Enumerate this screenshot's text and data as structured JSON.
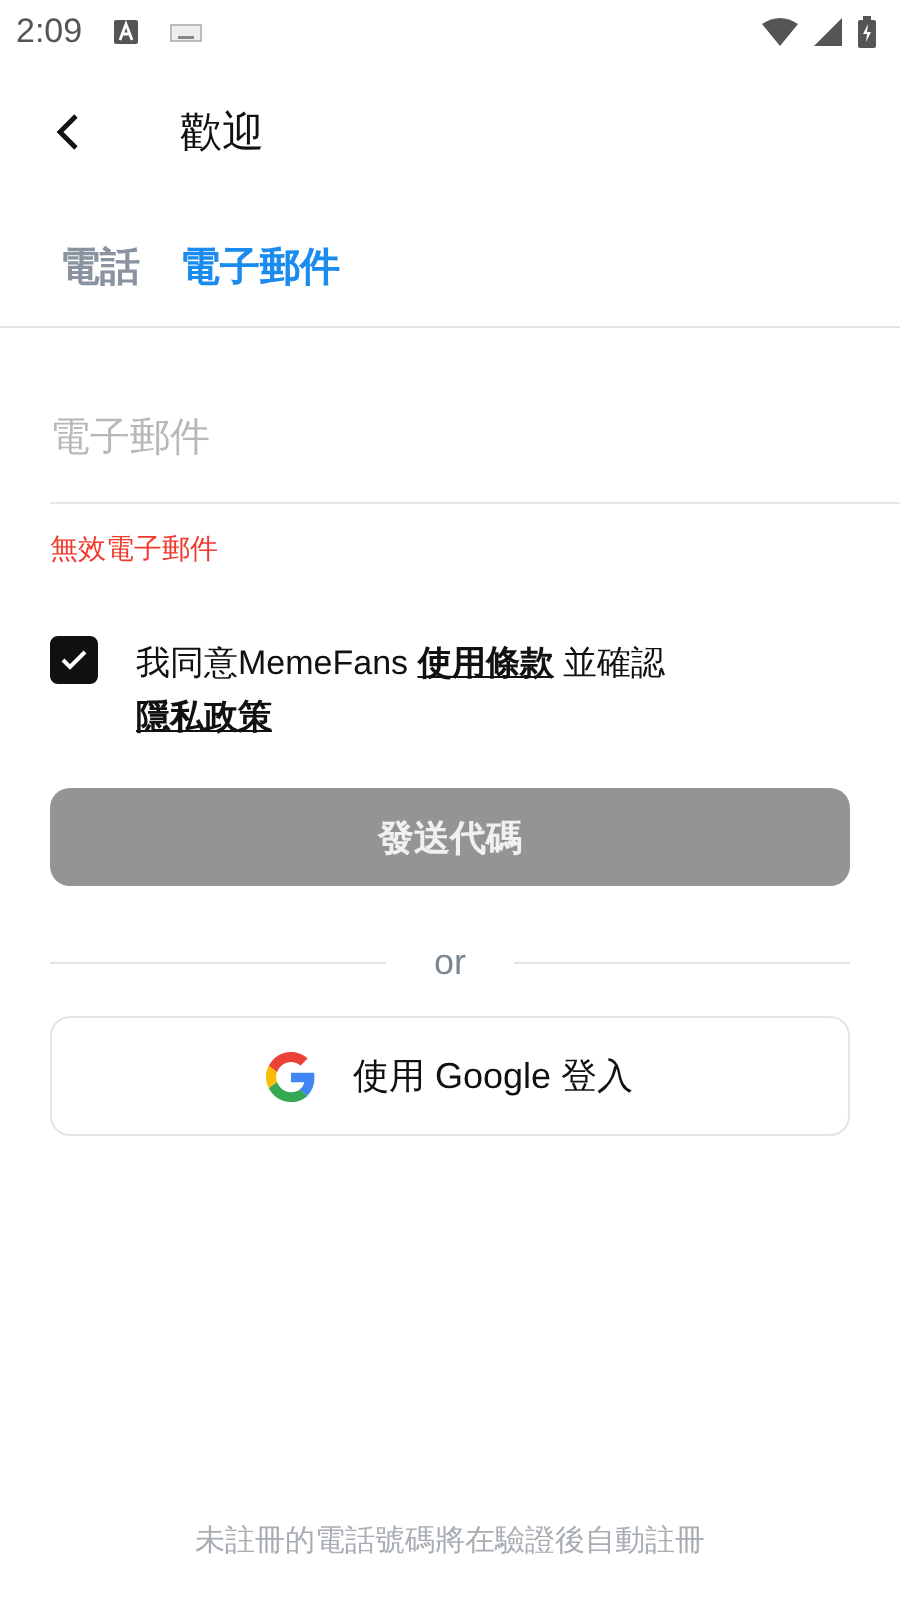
{
  "status_bar": {
    "time": "2:09"
  },
  "header": {
    "title": "歡迎"
  },
  "tabs": [
    {
      "label": "電話",
      "selected": false
    },
    {
      "label": "電子郵件",
      "selected": true
    }
  ],
  "email_field": {
    "placeholder": "電子郵件",
    "error": "無效電子郵件"
  },
  "agreement": {
    "checked": true,
    "text_before": "我同意MemeFans ",
    "terms_link": "使用條款",
    "text_middle": " 並確認",
    "privacy_link": "隱私政策"
  },
  "send_button": {
    "label": "發送代碼",
    "disabled": true
  },
  "divider_text": "or",
  "google_button": {
    "label": "使用 Google 登入"
  },
  "footer_note": "未註冊的電話號碼將在驗證後自動註冊"
}
